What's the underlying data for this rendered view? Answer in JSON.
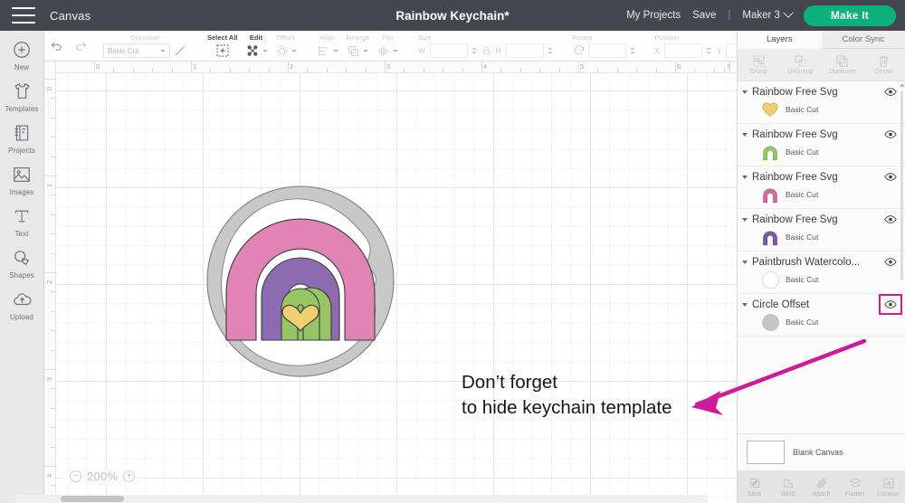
{
  "topbar": {
    "menu_icon": "hamburger-icon",
    "canvas_label": "Canvas",
    "doc_title": "Rainbow Keychain*",
    "my_projects": "My Projects",
    "save": "Save",
    "separator": "|",
    "machine": "Maker 3",
    "make_it": "Make It",
    "accent_green": "#0cb07a",
    "bar_bg": "#44474f"
  },
  "rail": {
    "items": [
      {
        "label": "New",
        "icon": "plus-circle-icon"
      },
      {
        "label": "Templates",
        "icon": "tshirt-icon"
      },
      {
        "label": "Projects",
        "icon": "notebook-icon"
      },
      {
        "label": "Images",
        "icon": "picture-icon"
      },
      {
        "label": "Text",
        "icon": "text-t-icon"
      },
      {
        "label": "Shapes",
        "icon": "shapes-icon"
      },
      {
        "label": "Upload",
        "icon": "cloud-upload-icon"
      }
    ]
  },
  "toolbar": {
    "undo": "undo-icon",
    "redo": "redo-icon",
    "operation_label": "Operation",
    "operation_value": "Basic Cut",
    "select_all": "Select All",
    "edit": "Edit",
    "offset": "Offset",
    "align": "Align",
    "arrange": "Arrange",
    "flip": "Flip",
    "size_label": "Size",
    "size_w": "W",
    "size_h": "H",
    "size_w_value": "",
    "size_h_value": "",
    "rotate_label": "Rotate",
    "rotate_value": "",
    "position_label": "Position",
    "position_x": "X",
    "position_y": "Y",
    "position_x_value": "",
    "position_y_value": ""
  },
  "canvas": {
    "zoom": "200%",
    "zoom_out": "−",
    "zoom_in": "+",
    "ruler_h": [
      "0",
      "1",
      "2",
      "3",
      "4",
      "5",
      "6",
      "7"
    ],
    "ruler_v": [
      "0",
      "1",
      "2",
      "3",
      "4"
    ],
    "annotation": "Don’t forget\nto hide keychain template",
    "annotation_color": "#15161a",
    "arrow_color": "#cf1a9b",
    "artwork": {
      "name": "rainbow-keychain",
      "offset_ring": "#c8c8c8",
      "offset_ring_stroke": "#8a8a8a",
      "watercolor_circle": "#ffffff",
      "arc_pink": "#e283b6",
      "arc_pink_stroke": "#3b3b3b",
      "arc_purple": "#8d6bb0",
      "arc_green": "#97c464",
      "heart": "#f0cf70",
      "heart_stroke": "#3b3b3b"
    }
  },
  "panel": {
    "tabs": [
      {
        "label": "Layers",
        "active": true
      },
      {
        "label": "Color Sync",
        "active": false
      }
    ],
    "actions": [
      {
        "label": "Group",
        "icon": "group-icon"
      },
      {
        "label": "UnGroup",
        "icon": "ungroup-icon"
      },
      {
        "label": "Duplicate",
        "icon": "duplicate-icon"
      },
      {
        "label": "Delete",
        "icon": "trash-icon"
      }
    ],
    "layers": [
      {
        "name": "Rainbow Free Svg",
        "operation": "Basic Cut",
        "swatch": "heart",
        "color": "#f0cf70",
        "highlight": false
      },
      {
        "name": "Rainbow Free Svg",
        "operation": "Basic Cut",
        "swatch": "arc",
        "color": "#97c464",
        "highlight": false
      },
      {
        "name": "Rainbow Free Svg",
        "operation": "Basic Cut",
        "swatch": "arc",
        "color": "#d46ba0",
        "highlight": false
      },
      {
        "name": "Rainbow Free Svg",
        "operation": "Basic Cut",
        "swatch": "arc",
        "color": "#7a5ca6",
        "highlight": false
      },
      {
        "name": "Paintbrush Watercolo...",
        "operation": "Basic Cut",
        "swatch": "circle",
        "color": "#ffffff",
        "highlight": false
      },
      {
        "name": "Circle Offset",
        "operation": "Basic Cut",
        "swatch": "circle",
        "color": "#c4c4c4",
        "highlight": true
      }
    ],
    "blank_canvas": "Blank Canvas",
    "tools": [
      {
        "label": "Slice",
        "icon": "slice-icon"
      },
      {
        "label": "Weld",
        "icon": "weld-icon"
      },
      {
        "label": "Attach",
        "icon": "paperclip-icon"
      },
      {
        "label": "Flatten",
        "icon": "flatten-icon"
      },
      {
        "label": "Contour",
        "icon": "contour-icon"
      }
    ]
  }
}
